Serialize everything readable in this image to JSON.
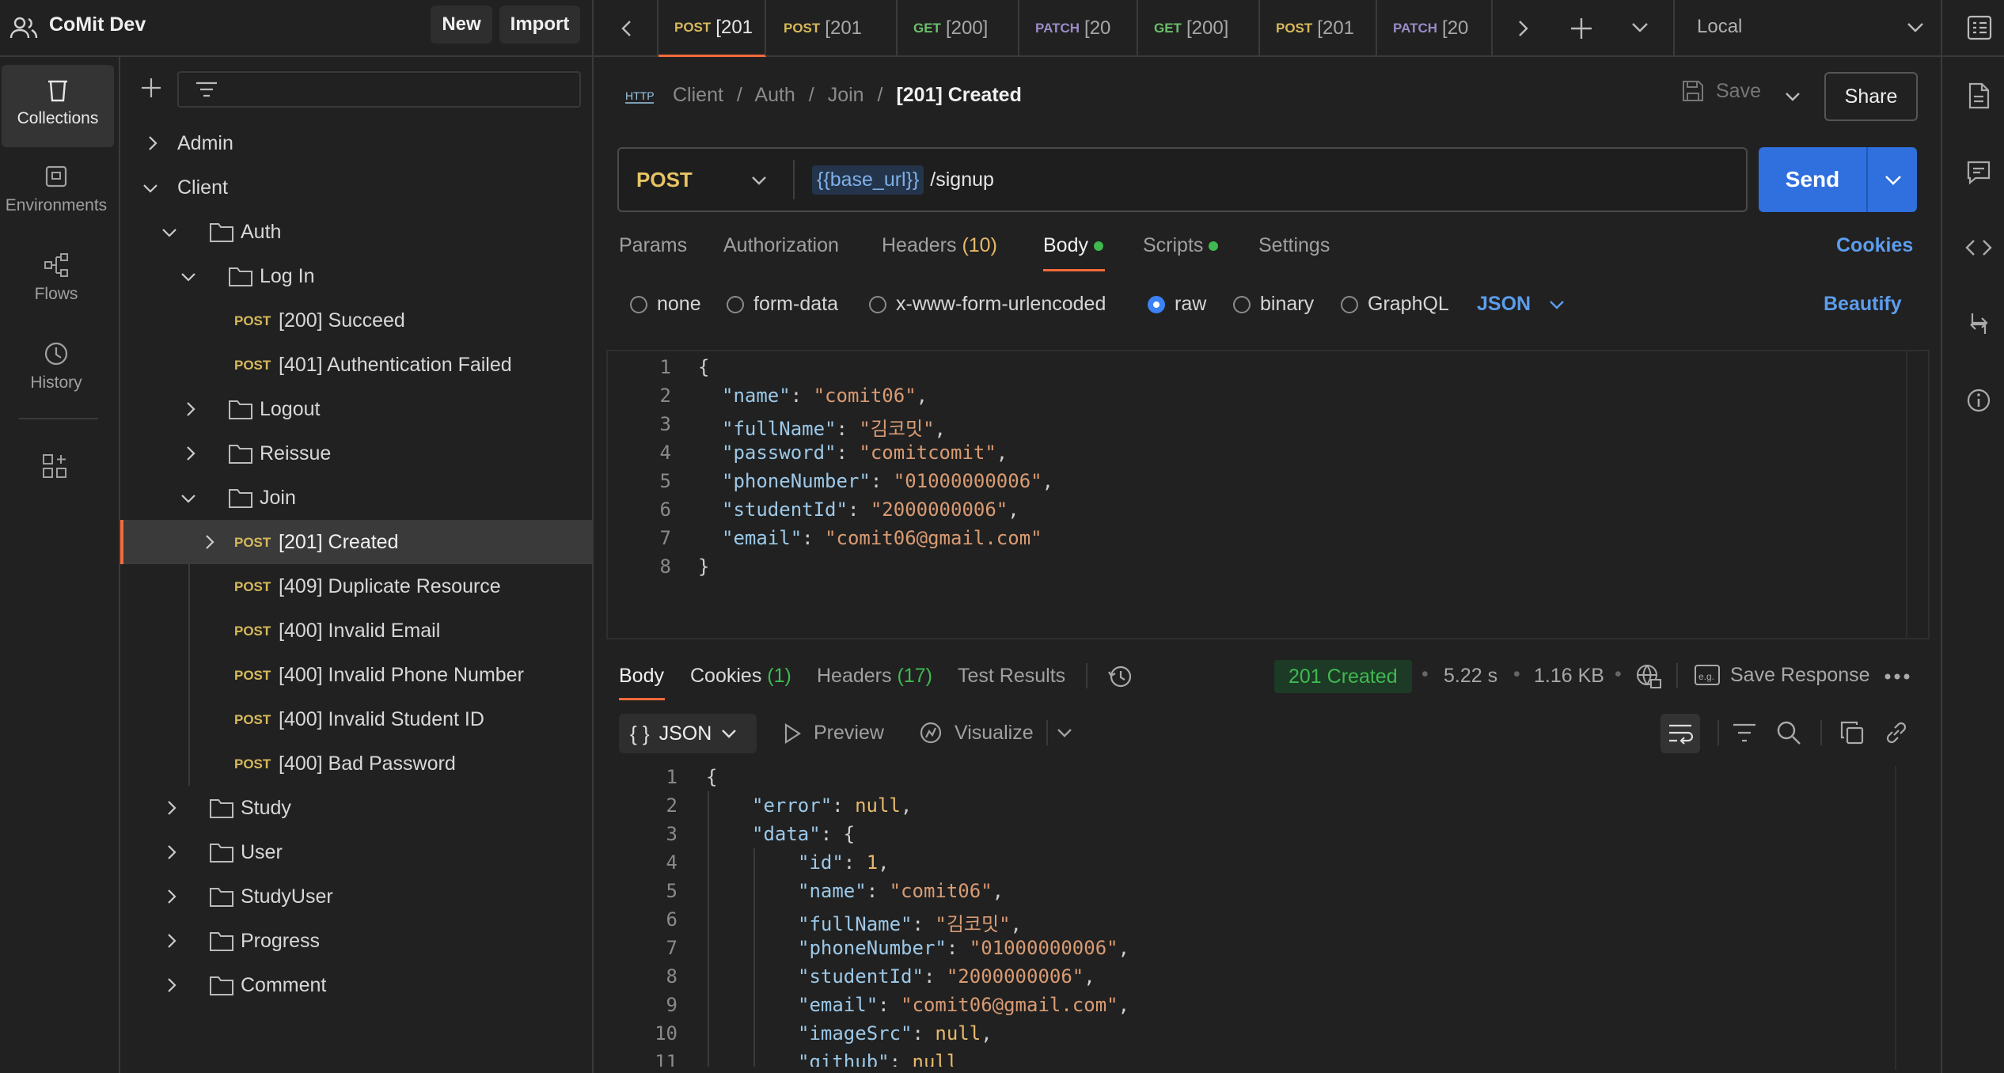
{
  "workspace": {
    "name": "CoMit Dev",
    "new_label": "New",
    "import_label": "Import"
  },
  "tabs": [
    {
      "method": "POST",
      "label": "[201",
      "active": true
    },
    {
      "method": "POST",
      "label": "[201"
    },
    {
      "method": "GET",
      "label": "[200]"
    },
    {
      "method": "PATCH",
      "label": "[20"
    },
    {
      "method": "GET",
      "label": "[200]"
    },
    {
      "method": "POST",
      "label": "[201"
    },
    {
      "method": "PATCH",
      "label": "[20"
    }
  ],
  "environment": "Local",
  "rail": [
    {
      "label": "Collections"
    },
    {
      "label": "Environments"
    },
    {
      "label": "Flows"
    },
    {
      "label": "History"
    }
  ],
  "tree": [
    {
      "label": "Admin"
    },
    {
      "label": "Client"
    },
    {
      "label": "Auth"
    },
    {
      "label": "Log In"
    },
    {
      "method": "POST",
      "label": "[200] Succeed"
    },
    {
      "method": "POST",
      "label": "[401] Authentication Failed"
    },
    {
      "label": "Logout"
    },
    {
      "label": "Reissue"
    },
    {
      "label": "Join"
    },
    {
      "method": "POST",
      "label": "[201] Created"
    },
    {
      "method": "POST",
      "label": "[409] Duplicate Resource"
    },
    {
      "method": "POST",
      "label": "[400] Invalid Email"
    },
    {
      "method": "POST",
      "label": "[400] Invalid Phone Number"
    },
    {
      "method": "POST",
      "label": "[400] Invalid Student ID"
    },
    {
      "method": "POST",
      "label": "[400] Bad Password"
    },
    {
      "label": "Study"
    },
    {
      "label": "User"
    },
    {
      "label": "StudyUser"
    },
    {
      "label": "Progress"
    },
    {
      "label": "Comment"
    }
  ],
  "breadcrumb": {
    "a": "Client",
    "b": "Auth",
    "c": "Join",
    "current": "[201] Created",
    "sep": "/"
  },
  "request": {
    "save_label": "Save",
    "share_label": "Share",
    "method": "POST",
    "url_var": "{{base_url}}",
    "url_path": "/signup",
    "send_label": "Send"
  },
  "req_tabs": {
    "params": "Params",
    "authorization": "Authorization",
    "headers": "Headers",
    "headers_count": "(10)",
    "body": "Body",
    "scripts": "Scripts",
    "settings": "Settings",
    "cookies": "Cookies"
  },
  "body_types": {
    "none": "none",
    "form_data": "form-data",
    "urlencoded": "x-www-form-urlencoded",
    "raw": "raw",
    "binary": "binary",
    "graphql": "GraphQL",
    "format": "JSON",
    "beautify": "Beautify"
  },
  "request_body": {
    "lines": [
      "1",
      "2",
      "3",
      "4",
      "5",
      "6",
      "7",
      "8"
    ],
    "k1": "\"name\"",
    "v1": "\"comit06\"",
    "k2": "\"fullName\"",
    "v2": "\"김코밋\"",
    "k3": "\"password\"",
    "v3": "\"comitcomit\"",
    "k4": "\"phoneNumber\"",
    "v4": "\"01000000006\"",
    "k5": "\"studentId\"",
    "v5": "\"2000000006\"",
    "k6": "\"email\"",
    "v6": "\"comit06@gmail.com\""
  },
  "response": {
    "body": "Body",
    "cookies": "Cookies",
    "cookies_count": "(1)",
    "headers": "Headers",
    "headers_count": "(17)",
    "test_results": "Test Results",
    "status": "201 Created",
    "time": "5.22 s",
    "size": "1.16 KB",
    "save_response": "Save Response",
    "format": "JSON",
    "preview": "Preview",
    "visualize": "Visualize",
    "lines": [
      "1",
      "2",
      "3",
      "4",
      "5",
      "6",
      "7",
      "8",
      "9",
      "10",
      "11"
    ],
    "k_error": "\"error\"",
    "v_null": "null",
    "k_data": "\"data\"",
    "k_id": "\"id\"",
    "v_id": "1",
    "k_name": "\"name\"",
    "v_name": "\"comit06\"",
    "k_fullName": "\"fullName\"",
    "v_fullName": "\"김코밋\"",
    "k_phone": "\"phoneNumber\"",
    "v_phone": "\"01000000006\"",
    "k_student": "\"studentId\"",
    "v_student": "\"2000000006\"",
    "k_email": "\"email\"",
    "v_email": "\"comit06@gmail.com\"",
    "k_image": "\"imageSrc\"",
    "v_image": "null",
    "k_github": "\"github\"",
    "v_github": "null"
  }
}
